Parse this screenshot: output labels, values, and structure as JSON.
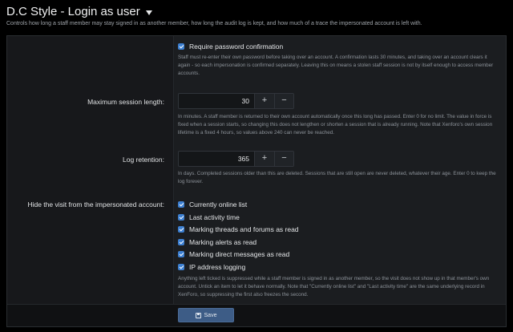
{
  "page": {
    "title": "D.C Style - Login as user",
    "description": "Controls how long a staff member may stay signed in as another member, how long the audit log is kept, and how much of a trace the impersonated account is left with."
  },
  "require_password": {
    "label": "Require password confirmation",
    "checked": true,
    "hint": "Staff must re-enter their own password before taking over an account. A confirmation lasts 30 minutes, and taking over an account clears it again - so each impersonation is confirmed separately. Leaving this on means a stolen staff session is not by itself enough to access member accounts."
  },
  "max_session": {
    "label": "Maximum session length:",
    "value": "30",
    "plus": "+",
    "minus": "−",
    "hint": "In minutes. A staff member is returned to their own account automatically once this long has passed. Enter 0 for no limit. The value in force is fixed when a session starts, so changing this does not lengthen or shorten a session that is already running. Note that Xenforo's own session lifetime is a fixed 4 hours, so values above 240 can never be reached."
  },
  "log_retention": {
    "label": "Log retention:",
    "value": "365",
    "plus": "+",
    "minus": "−",
    "hint": "In days. Completed sessions older than this are deleted. Sessions that are still open are never deleted, whatever their age. Enter 0 to keep the log forever."
  },
  "hide_visit": {
    "label": "Hide the visit from the impersonated account:",
    "options": [
      {
        "label": "Currently online list",
        "checked": true
      },
      {
        "label": "Last activity time",
        "checked": true
      },
      {
        "label": "Marking threads and forums as read",
        "checked": true
      },
      {
        "label": "Marking alerts as read",
        "checked": true
      },
      {
        "label": "Marking direct messages as read",
        "checked": true
      },
      {
        "label": "IP address logging",
        "checked": true
      }
    ],
    "hint": "Anything left ticked is suppressed while a staff member is signed in as another member, so the visit does not show up in that member's own account. Untick an item to let it behave normally. Note that \"Currently online list\" and \"Last activity time\" are the same underlying record in XenForo, so suppressing the first also freezes the second."
  },
  "footer": {
    "save_label": "Save"
  },
  "colors": {
    "accent": "#3c7fd1",
    "save_button": "#3d5c86"
  }
}
